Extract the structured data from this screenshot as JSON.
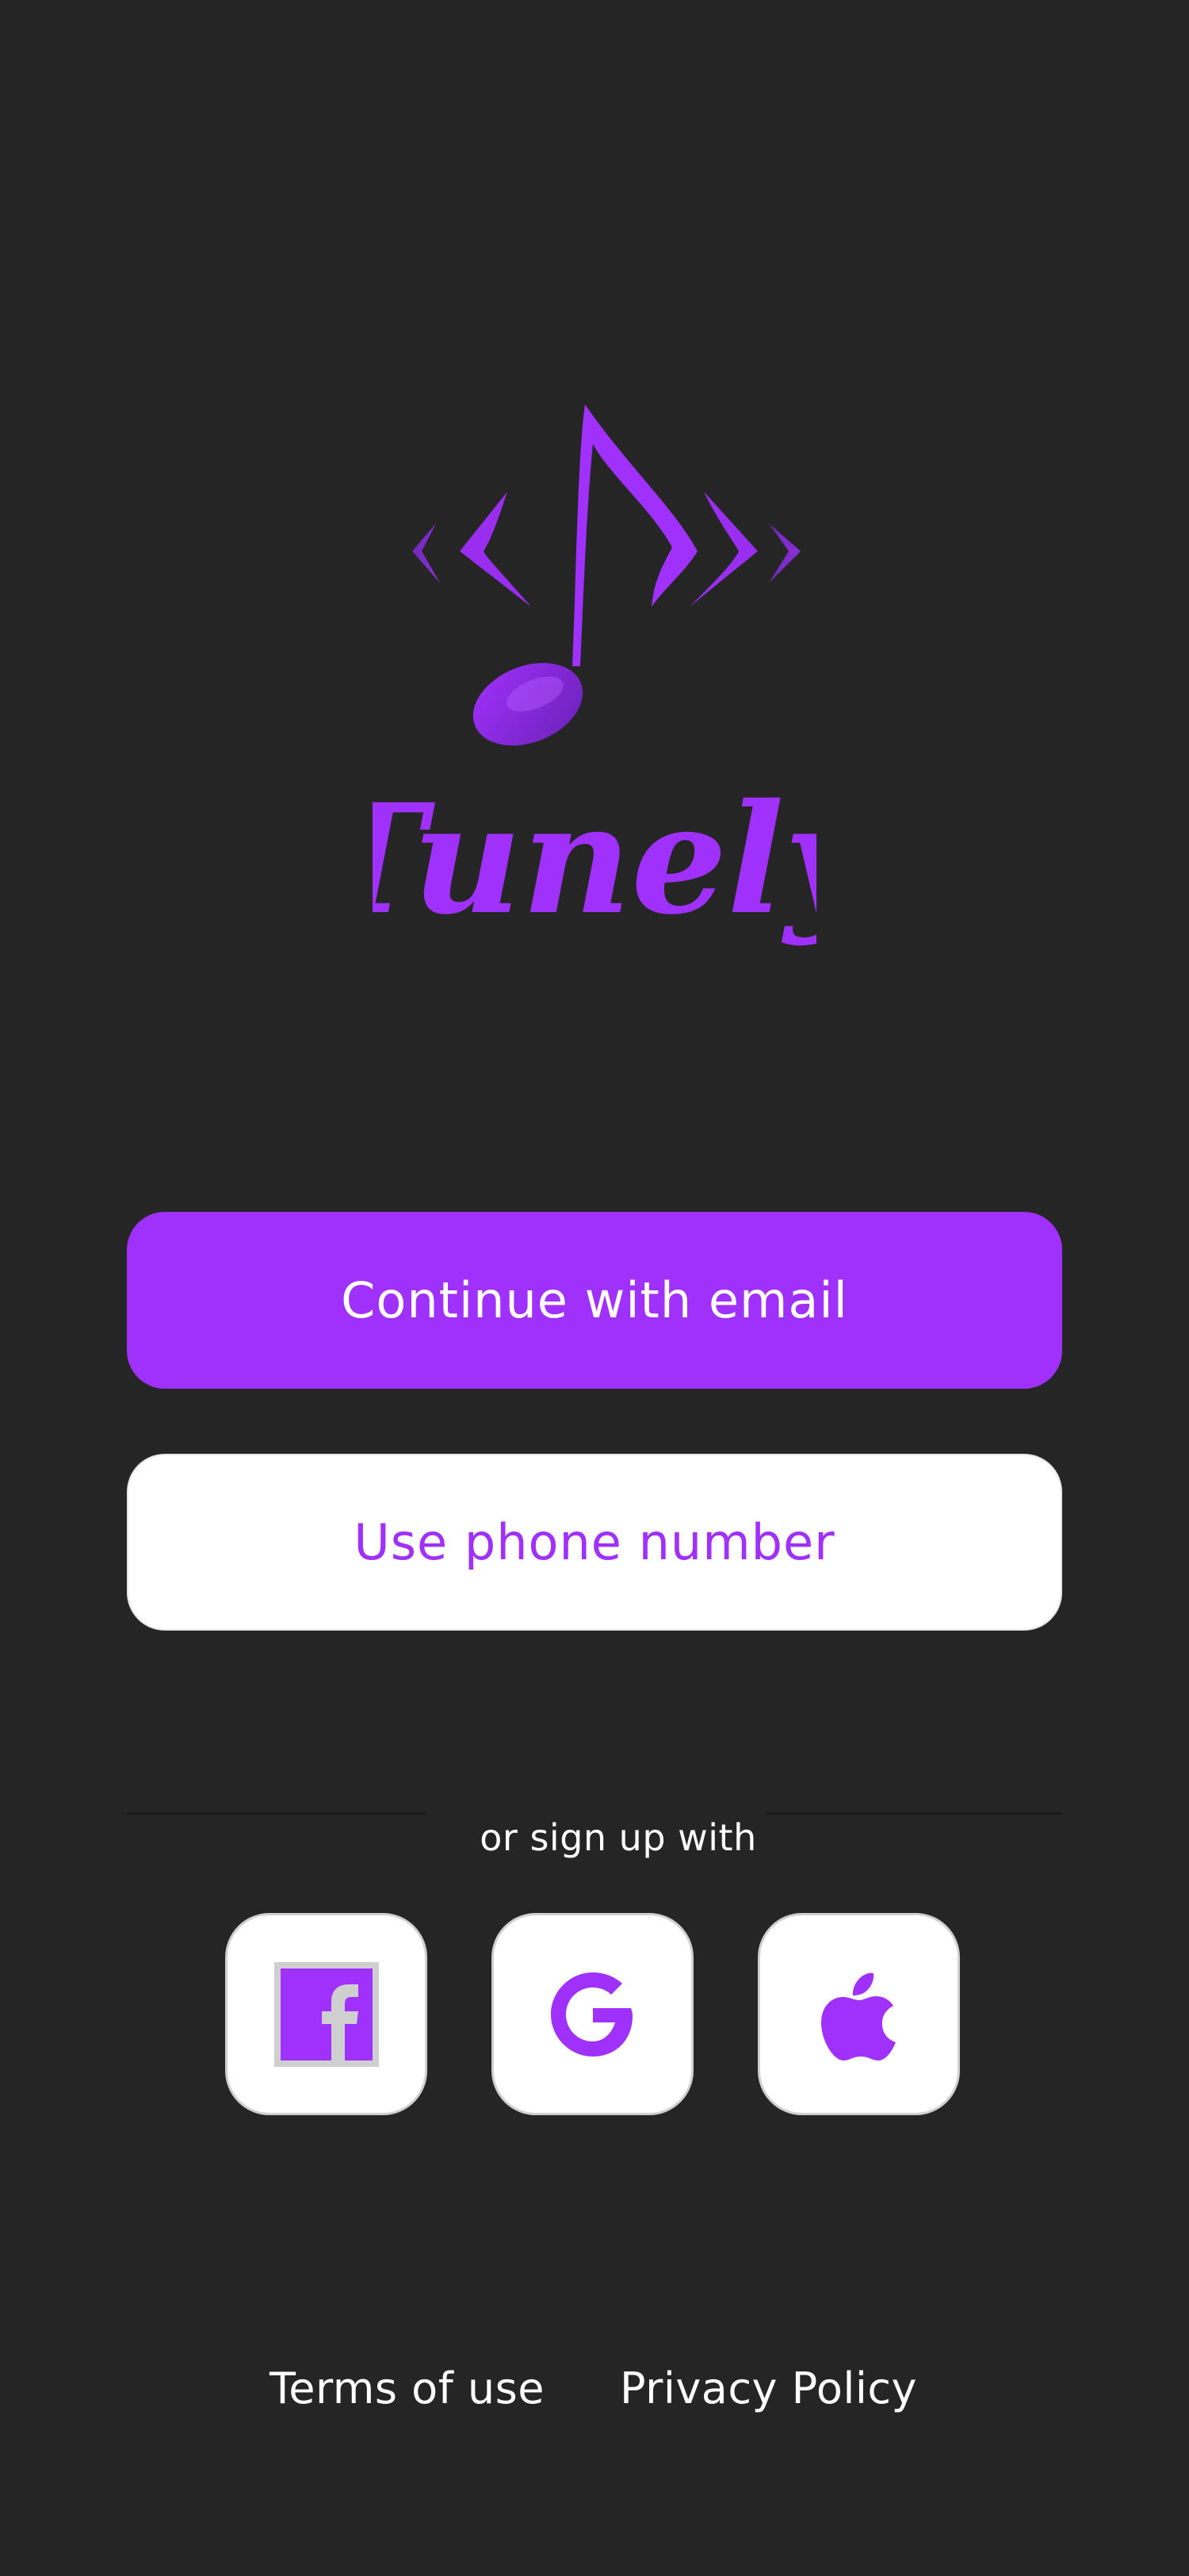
{
  "app": {
    "name": "Tunely"
  },
  "theme": {
    "background": "#252526",
    "accent": "#a030fb",
    "button_light": "#ffffff"
  },
  "actions": {
    "email_label": "Continue with email",
    "phone_label": "Use phone number"
  },
  "divider": {
    "label": "or sign up with"
  },
  "social": [
    {
      "name": "facebook",
      "icon": "facebook-icon"
    },
    {
      "name": "google",
      "icon": "google-icon"
    },
    {
      "name": "apple",
      "icon": "apple-icon"
    }
  ],
  "footer": {
    "terms_label": "Terms of use",
    "privacy_label": "Privacy Policy"
  }
}
